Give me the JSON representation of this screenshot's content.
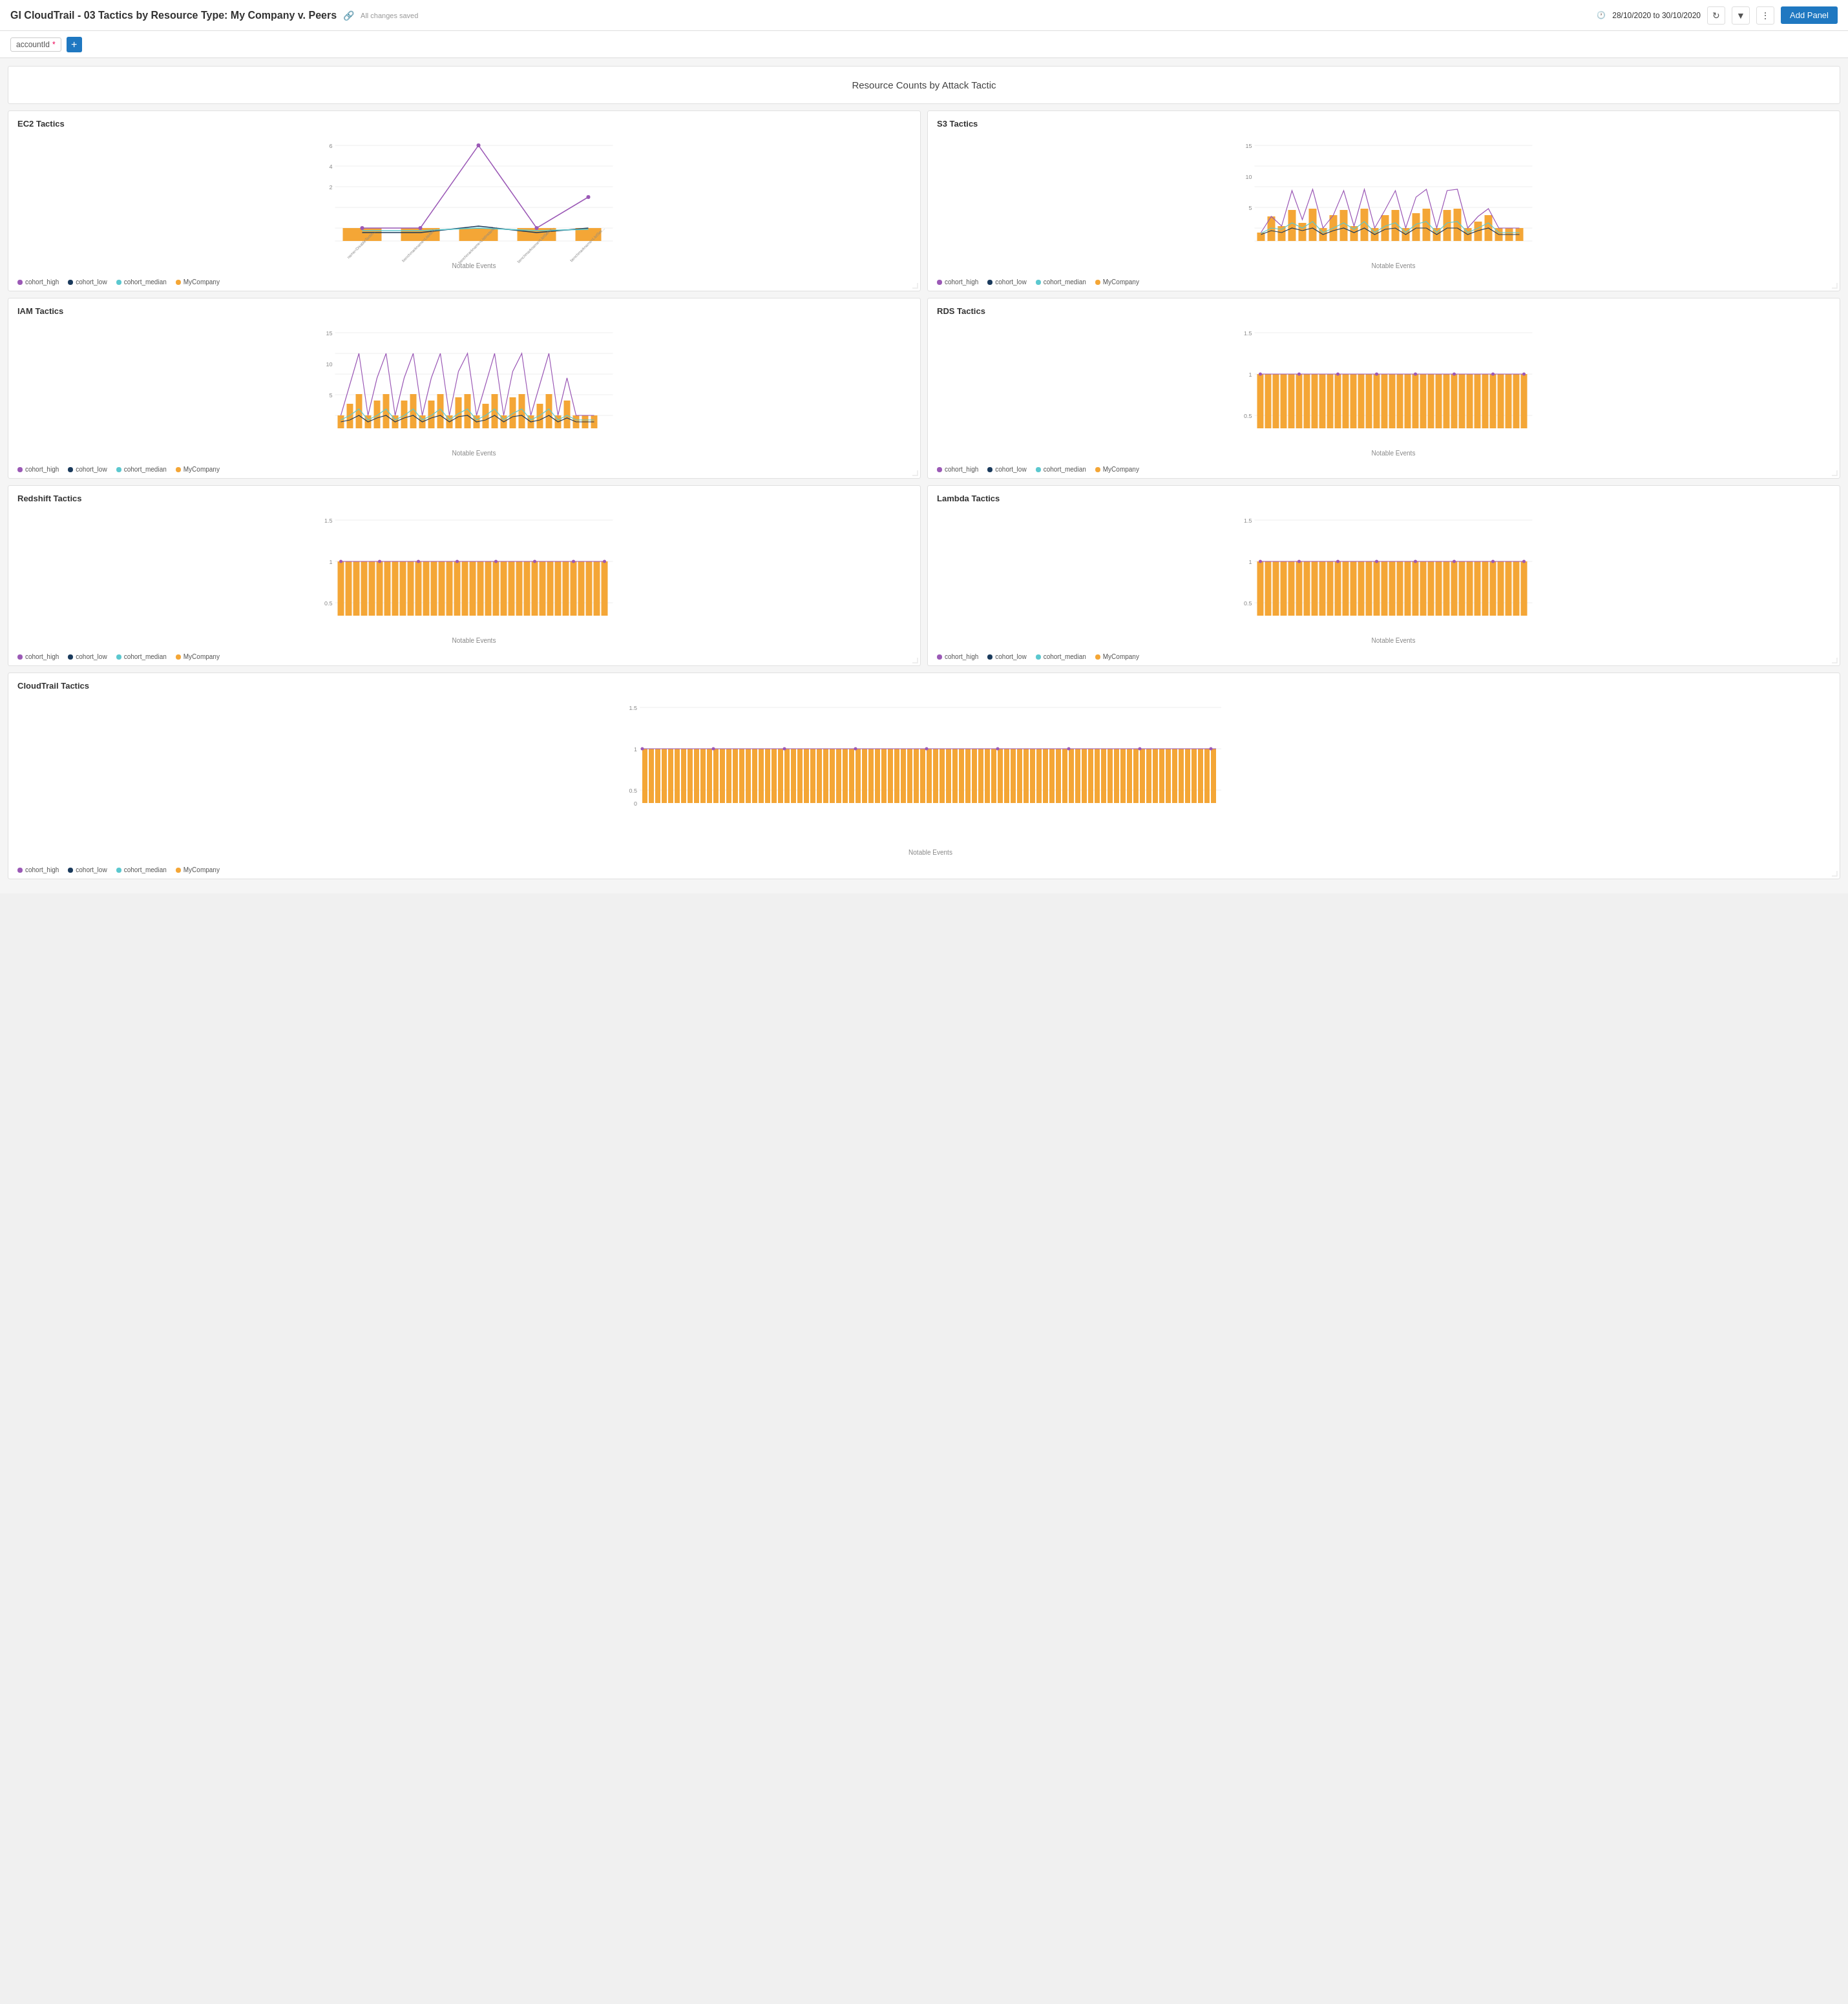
{
  "header": {
    "title": "GI CloudTrail - 03 Tactics by Resource Type: My Company v. Peers",
    "save_icon": "💾",
    "saved_status": "All changes saved",
    "date_range": "28/10/2020 to 30/10/2020",
    "add_panel_label": "Add Panel"
  },
  "filter_bar": {
    "filter_label": "accountId",
    "filter_asterisk": "*",
    "add_label": "+"
  },
  "dashboard": {
    "main_title": "Resource Counts by Attack Tactic",
    "panels": [
      {
        "id": "ec2",
        "title": "EC2 Tactics",
        "y_max": 6,
        "x_label": "Notable Events",
        "type": "line_bar"
      },
      {
        "id": "s3",
        "title": "S3 Tactics",
        "y_max": 15,
        "x_label": "Notable Events",
        "type": "line_bar"
      },
      {
        "id": "iam",
        "title": "IAM Tactics",
        "y_max": 15,
        "x_label": "Notable Events",
        "type": "line_bar"
      },
      {
        "id": "rds",
        "title": "RDS Tactics",
        "y_max": 1.5,
        "x_label": "Notable Events",
        "type": "bar"
      },
      {
        "id": "redshift",
        "title": "Redshift Tactics",
        "y_max": 1.5,
        "x_label": "Notable Events",
        "type": "bar"
      },
      {
        "id": "lambda",
        "title": "Lambda Tactics",
        "y_max": 1.5,
        "x_label": "Notable Events",
        "type": "bar"
      },
      {
        "id": "cloudtrail",
        "title": "CloudTrail Tactics",
        "y_max": 1.5,
        "x_label": "Notable Events",
        "type": "bar",
        "full_width": true
      }
    ],
    "legend": {
      "items": [
        {
          "label": "cohort_high",
          "color": "#9b59b6"
        },
        {
          "label": "cohort_low",
          "color": "#1a3a5c"
        },
        {
          "label": "cohort_median",
          "color": "#5bc8cf"
        },
        {
          "label": "MyCompany",
          "color": "#f4a636"
        }
      ]
    }
  }
}
